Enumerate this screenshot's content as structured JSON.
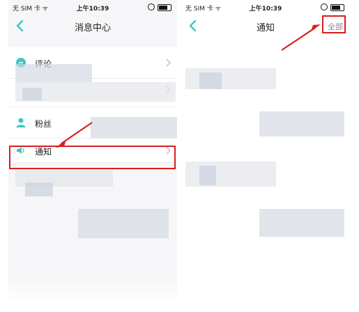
{
  "left_screen": {
    "status": {
      "carrier": "无 SIM 卡 ᯤ",
      "time": "上午10:39"
    },
    "nav": {
      "title": "消息中心"
    },
    "items": [
      {
        "label": "评论",
        "icon": "comment-icon",
        "color": "#3cc7c2"
      },
      {
        "label": "粉丝",
        "icon": "user-icon",
        "color": "#3cc7c2"
      },
      {
        "label": "通知",
        "icon": "speaker-icon",
        "color": "#3cc7c2"
      }
    ]
  },
  "right_screen": {
    "status": {
      "carrier": "无 SIM 卡 ᯤ",
      "time": "上午10:39"
    },
    "nav": {
      "title": "通知",
      "action": "全部"
    }
  },
  "colors": {
    "accent": "#3cc7c2",
    "highlight": "#d81e1e"
  }
}
